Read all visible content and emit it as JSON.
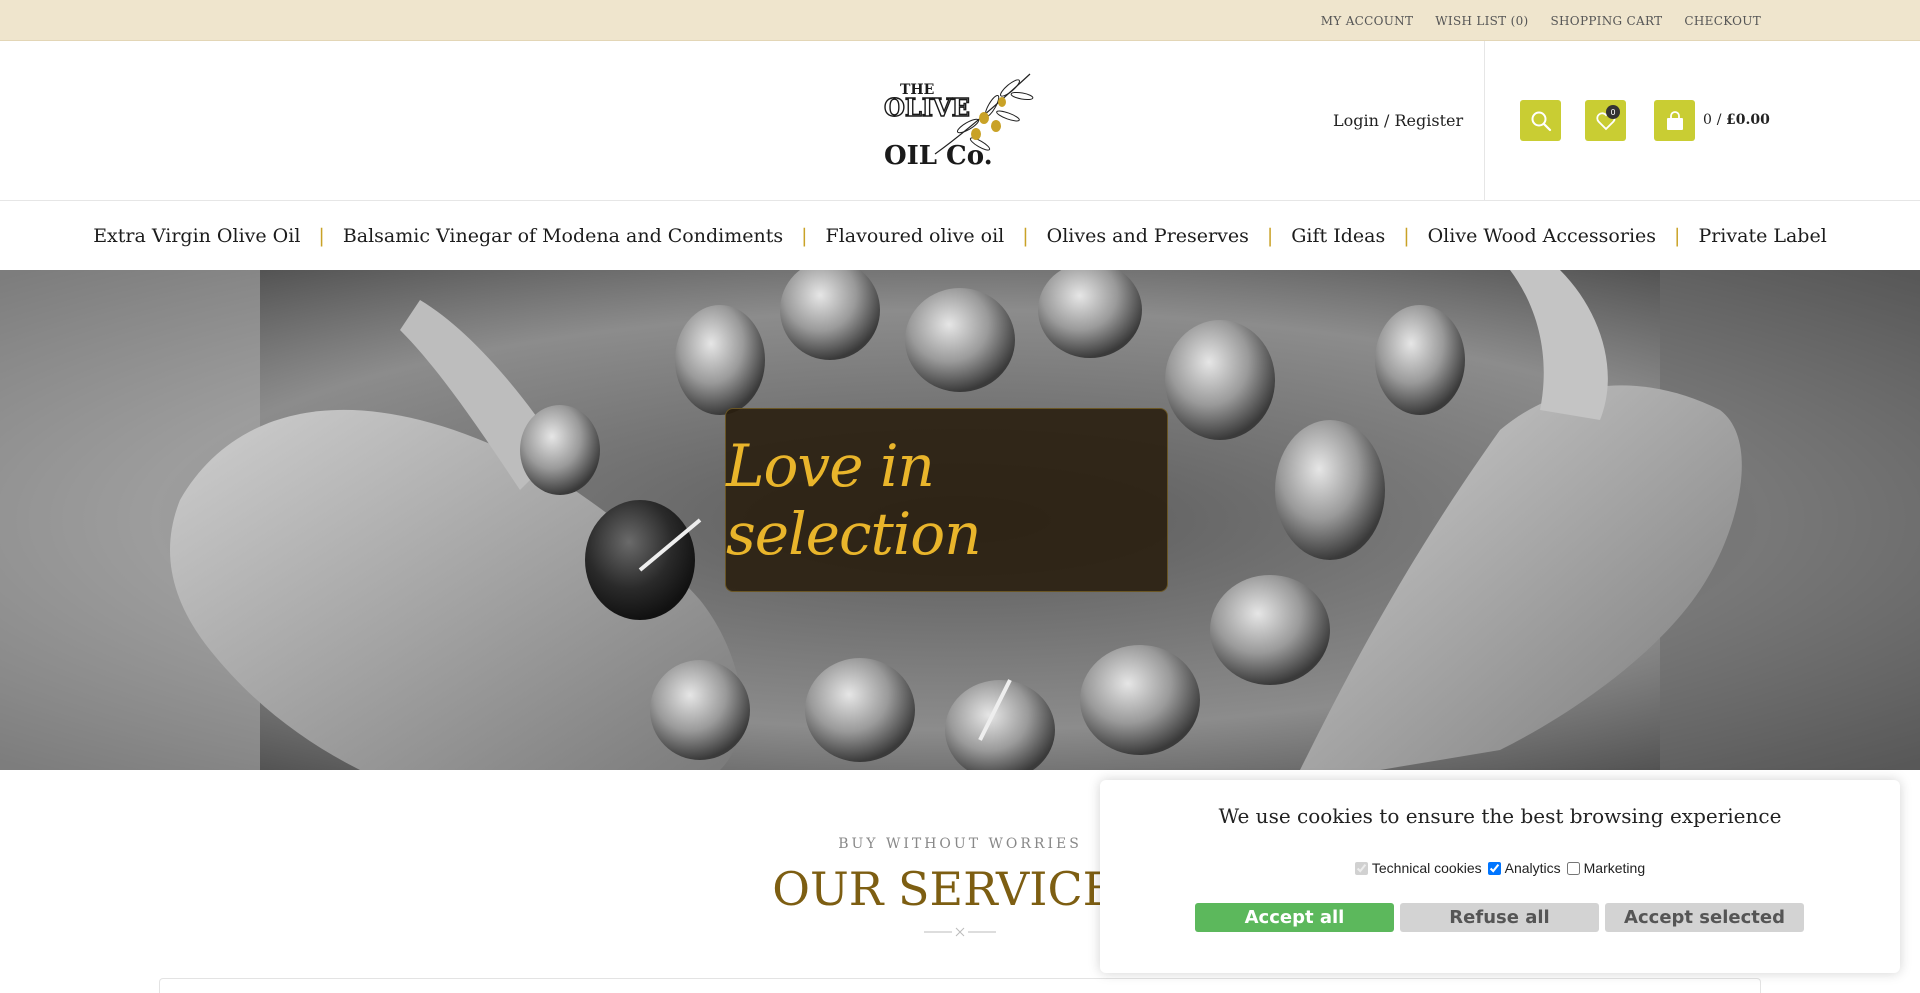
{
  "topbar": {
    "links": [
      "MY ACCOUNT",
      "WISH LIST (0)",
      "SHOPPING CART",
      "CHECKOUT"
    ]
  },
  "header": {
    "logo_text": [
      "THE",
      "OLIVE",
      "OIL",
      "Co."
    ],
    "login_label": "Login / Register",
    "wishlist_count": "0",
    "cart_count": "0",
    "cart_total": "£0.00"
  },
  "nav": {
    "items": [
      "Extra Virgin Olive Oil",
      "Balsamic Vinegar of Modena and Condiments",
      "Flavoured olive oil",
      "Olives and Preserves",
      "Gift Ideas",
      "Olive Wood Accessories",
      "Private Label"
    ],
    "separator": "|"
  },
  "hero": {
    "caption": "Love in selection"
  },
  "services": {
    "kicker": "BUY WITHOUT WORRIES",
    "title": "OUR SERVICES"
  },
  "cookie": {
    "title": "We use cookies to ensure the best browsing experience",
    "options": [
      {
        "label": "Technical cookies",
        "checked": true,
        "disabled": true
      },
      {
        "label": "Analytics",
        "checked": true,
        "disabled": false
      },
      {
        "label": "Marketing",
        "checked": false,
        "disabled": false
      }
    ],
    "accept_all": "Accept all",
    "refuse_all": "Refuse all",
    "accept_selected": "Accept selected"
  },
  "colors": {
    "topbar_bg": "#efe5cd",
    "accent_lime": "#c9cd33",
    "gold": "#c9a227",
    "title_brown": "#7d5e12",
    "accept_green": "#5cb85c"
  }
}
